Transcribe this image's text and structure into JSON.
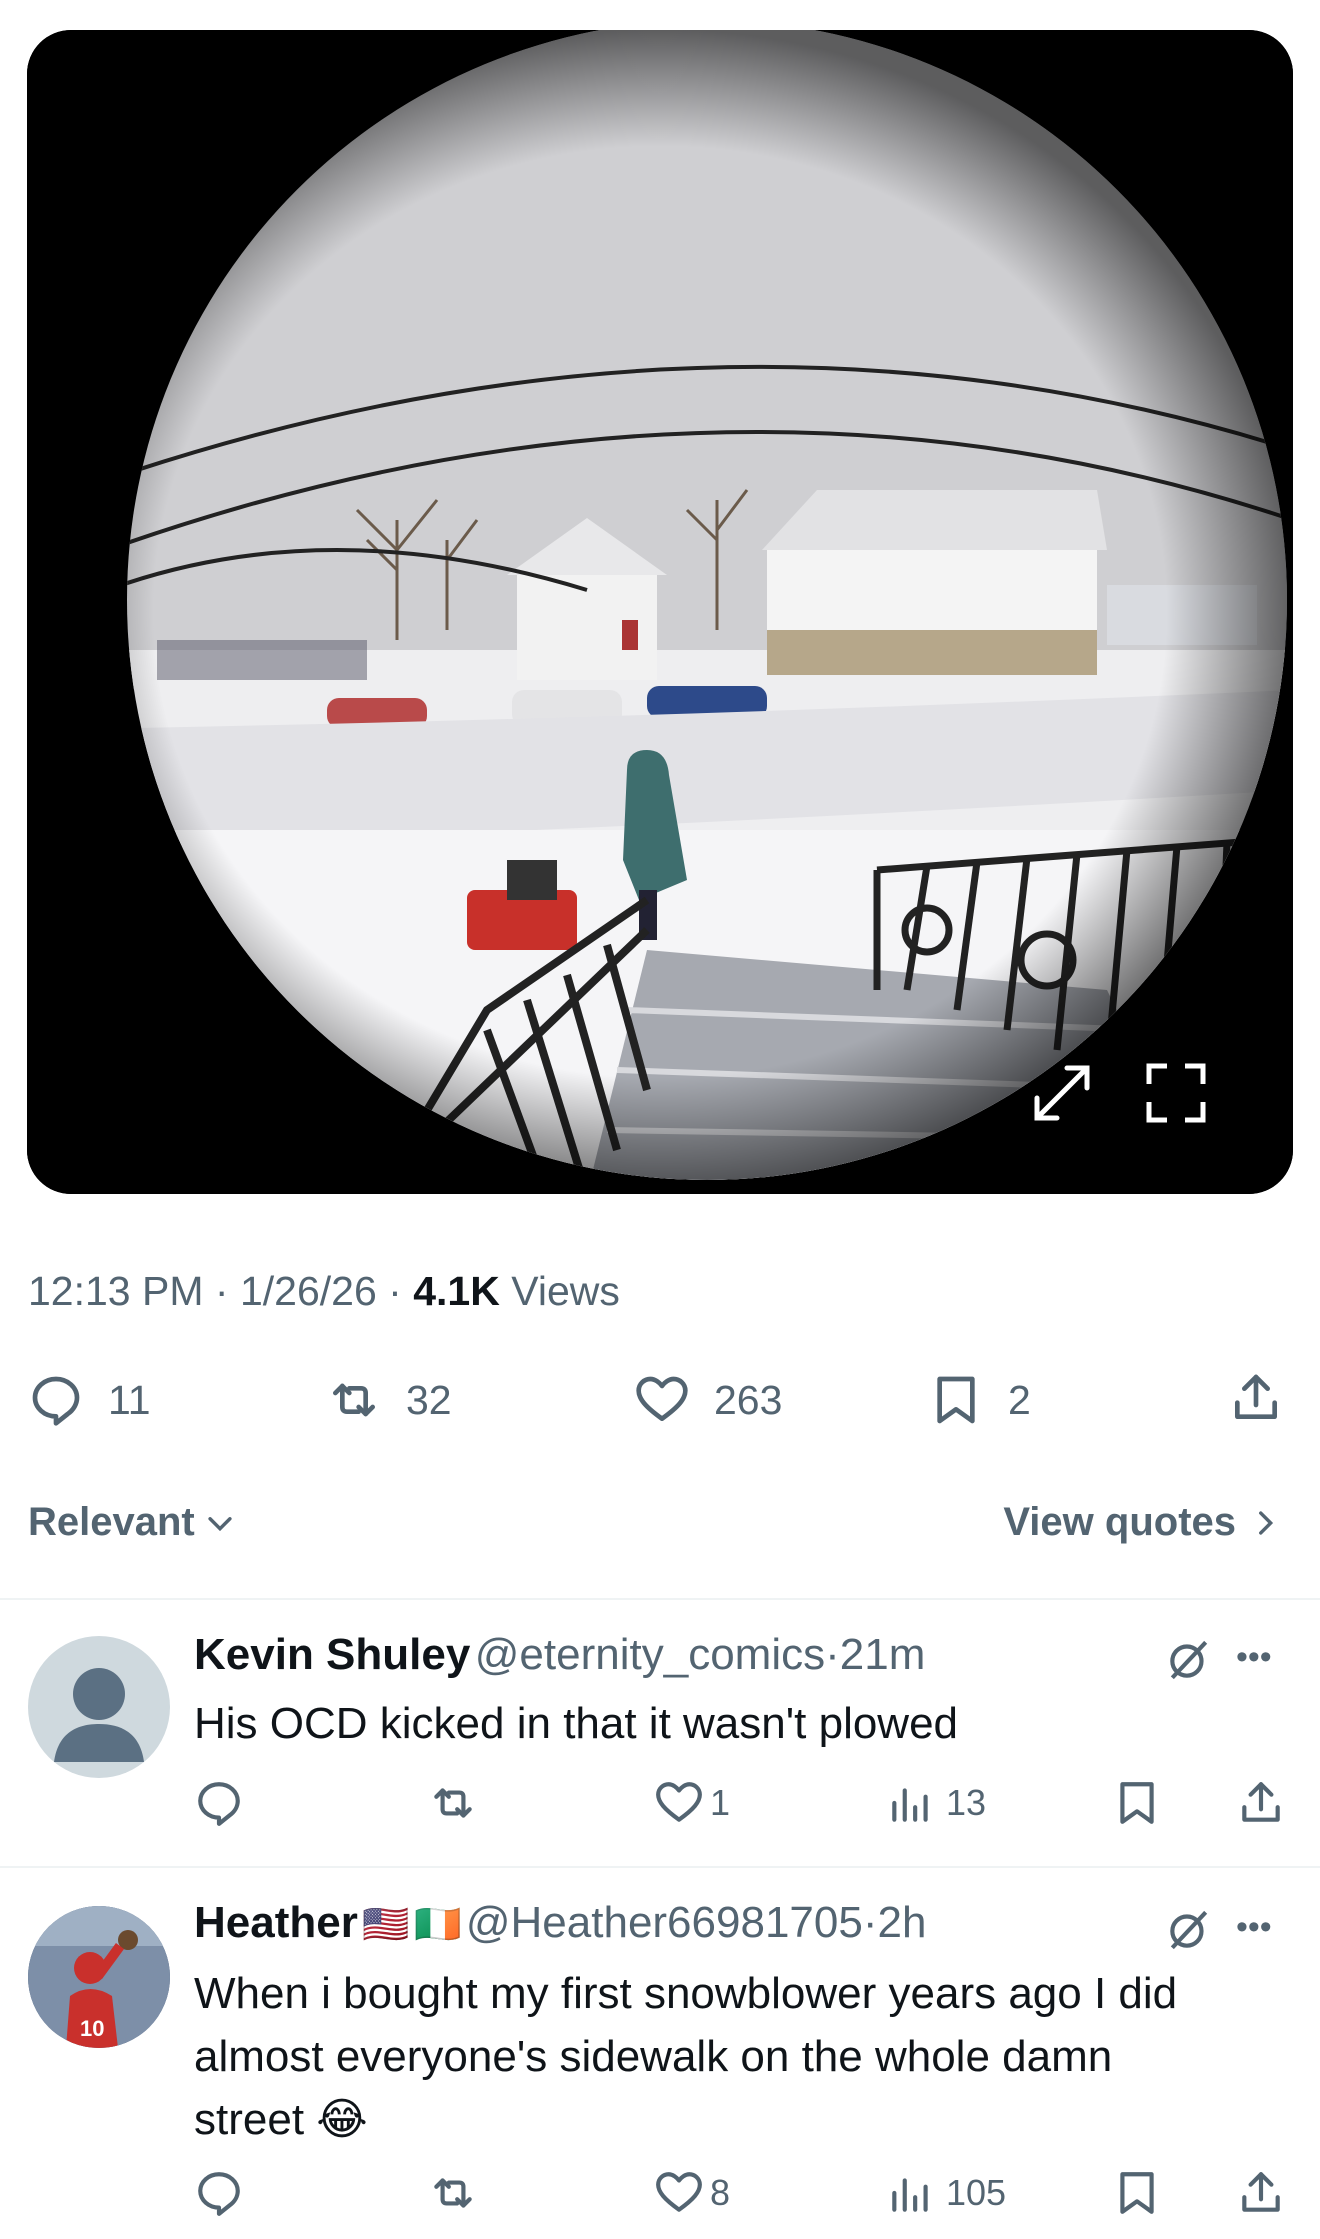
{
  "tweet": {
    "time": "12:13 PM",
    "sep1": "·",
    "date": "1/26/26",
    "sep2": "·",
    "views_count": "4.1K",
    "views_label": "Views",
    "replies": "11",
    "retweets": "32",
    "likes": "263",
    "bookmarks": "2"
  },
  "media": {
    "expand_icon": "expand-arrows-icon",
    "fullscreen_icon": "fullscreen-icon"
  },
  "filter": {
    "left_label": "Relevant",
    "right_label": "View quotes"
  },
  "replies": [
    {
      "name": "Kevin Shuley",
      "handle": "@eternity_comics",
      "sep": "·",
      "time": "21m",
      "text": "His OCD kicked in that it wasn't plowed",
      "replies": "",
      "retweets": "",
      "likes": "1",
      "views": "13"
    },
    {
      "name": "Heather",
      "flags": [
        "🇺🇸",
        "🇮🇪"
      ],
      "handle": "@Heather66981705",
      "sep": "·",
      "time": "2h",
      "text_line1": "When i bought my first snowblower years ago I did",
      "text_line2": "almost everyone's sidewalk on the whole damn",
      "text_line3": "street",
      "emoji": "😂",
      "replies": "",
      "retweets": "",
      "likes": "8",
      "views": "105"
    }
  ],
  "colors": {
    "text_primary": "#0f1419",
    "text_secondary": "#536471",
    "divider": "#eff3f4"
  }
}
